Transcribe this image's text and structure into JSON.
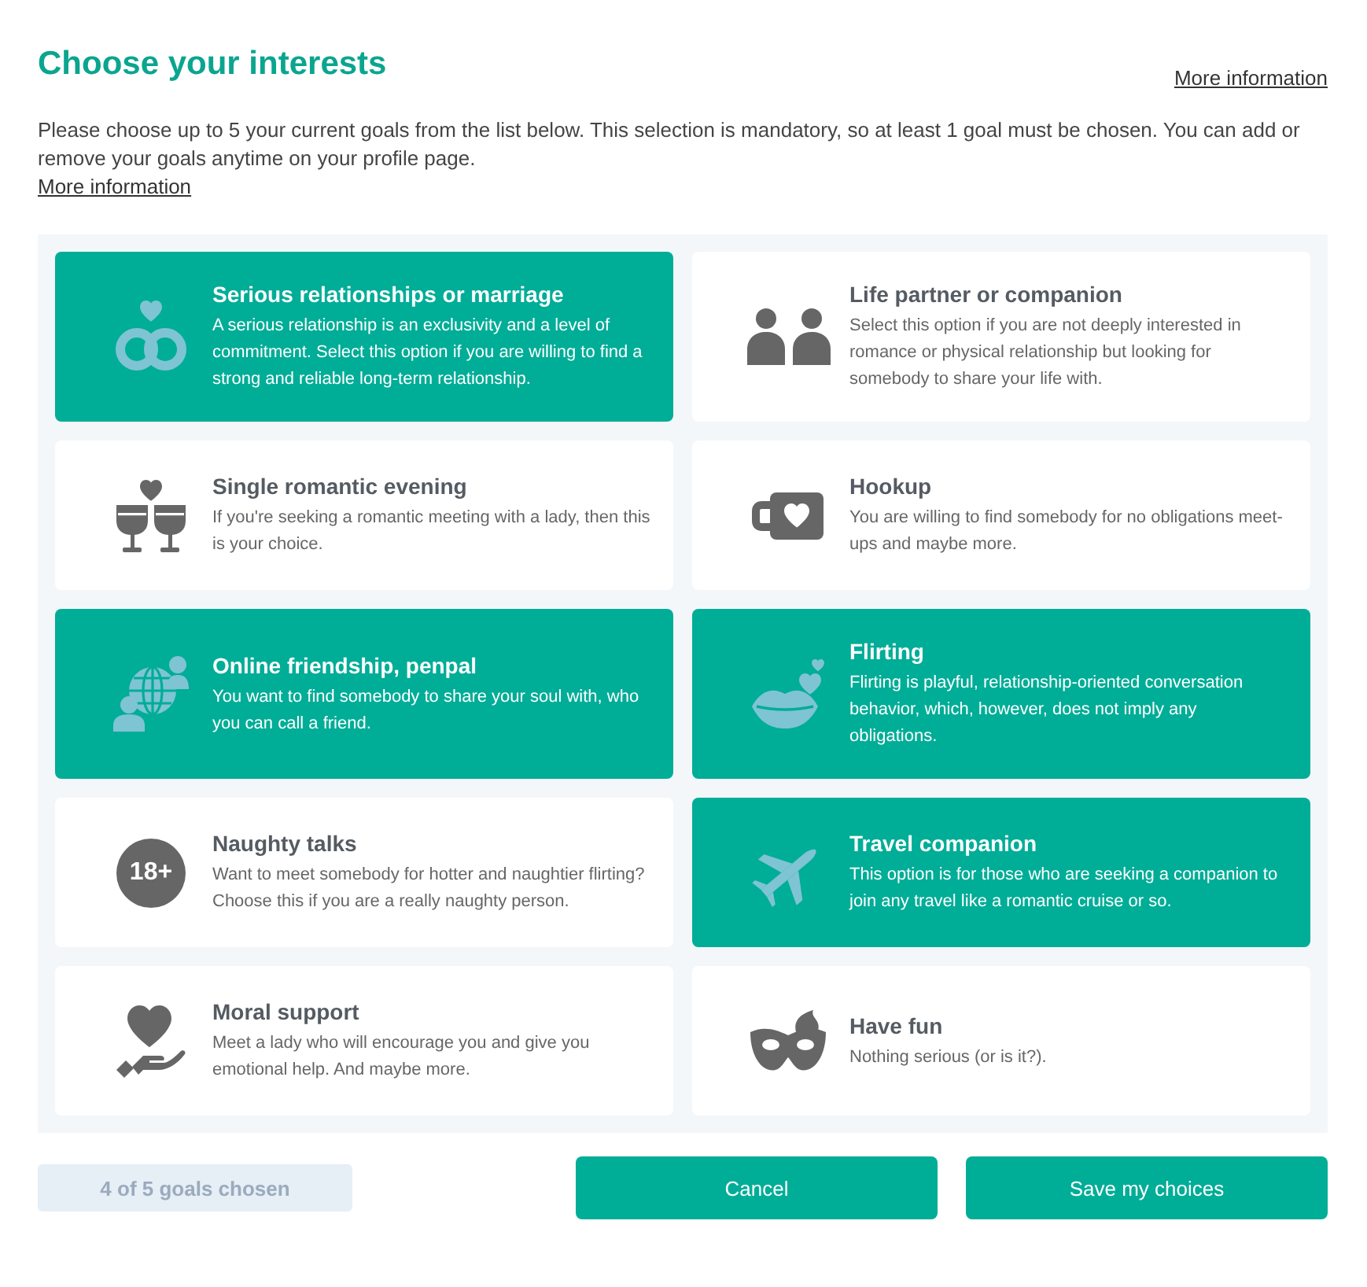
{
  "header": {
    "title": "Choose your interests",
    "link": "More information"
  },
  "intro": {
    "text": "Please choose up to 5 your current goals from the list below. This selection is mandatory, so at least 1 goal must be chosen. You can add or remove your goals anytime on your profile page.",
    "link": "More information"
  },
  "goals": [
    {
      "title": "Serious relationships or marriage",
      "description": "A serious relationship is an exclusivity and a level of commitment. Select this option if you are willing to find a strong and reliable long-term relationship.",
      "selected": true
    },
    {
      "title": "Life partner or companion",
      "description": "Select this option if you are not deeply interested in romance or physical relationship but looking for somebody to share your life with.",
      "selected": false
    },
    {
      "title": "Single romantic evening",
      "description": "If you're seeking a romantic meeting with a lady, then this is your choice.",
      "selected": false
    },
    {
      "title": "Hookup",
      "description": "You are willing to find somebody for no obligations meet-ups and maybe more.",
      "selected": false
    },
    {
      "title": "Online friendship, penpal",
      "description": "You want to find somebody to share your soul with, who you can call a friend.",
      "selected": true
    },
    {
      "title": "Flirting",
      "description": "Flirting is playful, relationship-oriented conversation behavior, which, however, does not imply any obligations.",
      "selected": true
    },
    {
      "title": "Naughty talks",
      "description": "Want to meet somebody for hotter and naughtier flirting? Choose this if you are a really naughty person.",
      "selected": false,
      "icon_text": "18+"
    },
    {
      "title": "Travel companion",
      "description": "This option is for those who are seeking a companion to join any travel like a romantic cruise or so.",
      "selected": true
    },
    {
      "title": "Moral support",
      "description": "Meet a lady who will encourage you and give you emotional help. And maybe more.",
      "selected": false
    },
    {
      "title": "Have fun",
      "description": "Nothing serious (or is it?).",
      "selected": false
    }
  ],
  "footer": {
    "counter": "4 of 5 goals chosen",
    "buttons": [
      "Cancel",
      "Save my choices"
    ]
  }
}
